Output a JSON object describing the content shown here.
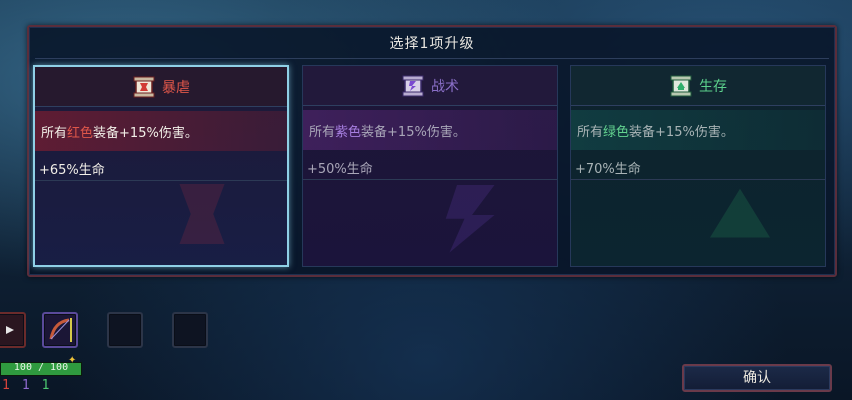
{
  "panel": {
    "title": "选择1项升级"
  },
  "cards": [
    {
      "category": "暴虐",
      "desc_prefix": "所有",
      "desc_color_word": "红色",
      "desc_suffix": "装备+15%伤害。",
      "stat": "+65%生命",
      "color": "#e0574a",
      "icon": "red-scroll-icon",
      "selected": true
    },
    {
      "category": "战术",
      "desc_prefix": "所有",
      "desc_color_word": "紫色",
      "desc_suffix": "装备+15%伤害。",
      "stat": "+50%生命",
      "color": "#8a6fc8",
      "icon": "purple-scroll-icon",
      "selected": false
    },
    {
      "category": "生存",
      "desc_prefix": "所有",
      "desc_color_word": "绿色",
      "desc_suffix": "装备+15%伤害。",
      "stat": "+70%生命",
      "color": "#5cd08c",
      "icon": "green-scroll-icon",
      "selected": false
    }
  ],
  "hud": {
    "hp_text": "100 / 100",
    "hp_fraction": 1.0,
    "stats": [
      "1",
      "1",
      "1"
    ],
    "slots": [
      "weapon-slot-icon",
      "bow-icon",
      "empty-slot",
      "empty-slot"
    ]
  },
  "confirm_label": "确认"
}
